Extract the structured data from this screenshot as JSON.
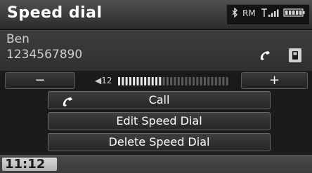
{
  "header": {
    "title": "Speed dial",
    "status": {
      "bluetooth_icon": "bluetooth-icon",
      "roaming": "RM",
      "signal_icon": "signal-strength-icon",
      "battery_icon": "battery-icon"
    }
  },
  "contact": {
    "name": "Ben",
    "number": "1234567890",
    "handset_icon": "handset-icon",
    "phone_icon": "cellphone-icon"
  },
  "volume": {
    "minus_label": "−",
    "plus_label": "+",
    "level_label": "◀12",
    "level": 12,
    "max": 30
  },
  "menu": {
    "call_label": "Call",
    "edit_label": "Edit Speed Dial",
    "delete_label": "Delete Speed Dial"
  },
  "footer": {
    "clock": "11:12"
  },
  "colors": {
    "background": "#1b1b1b",
    "text": "#ffffff",
    "button_border": "#6a6a6a"
  }
}
